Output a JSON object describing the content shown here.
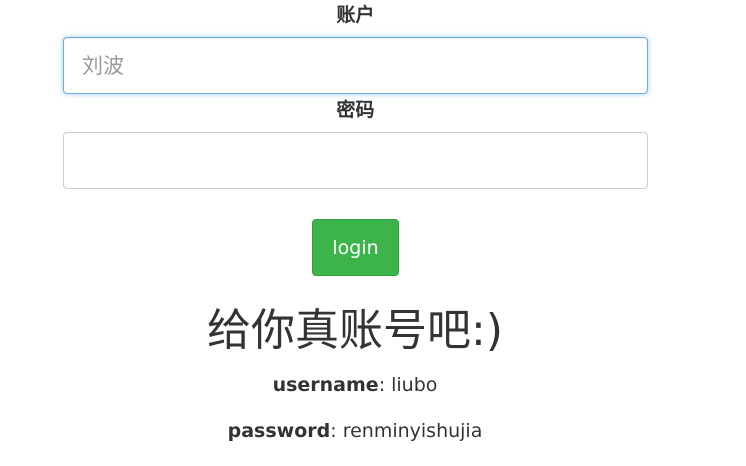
{
  "form": {
    "account_label": "账户",
    "account_placeholder": "刘波",
    "account_value": "",
    "password_label": "密码",
    "password_placeholder": "",
    "password_value": "",
    "login_label": "login"
  },
  "hint": {
    "title": "给你真账号吧:)",
    "username_key": "username",
    "username_value": ": liubo",
    "password_key": "password",
    "password_value": ": renminyishujia"
  },
  "colors": {
    "button": "#3cb449",
    "focus_border": "#66afe9",
    "text": "#333333"
  }
}
